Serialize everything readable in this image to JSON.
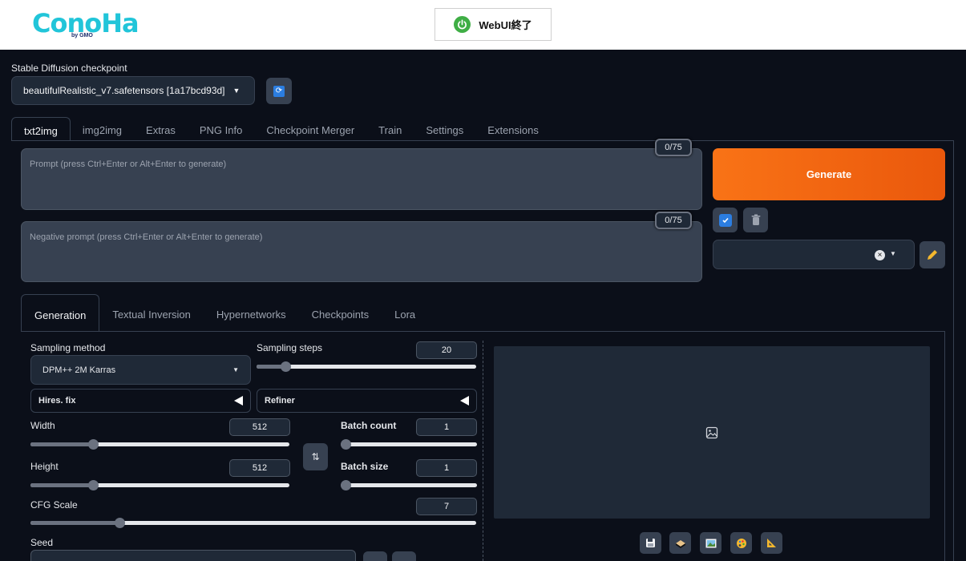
{
  "header": {
    "logo_text": "ConoHa",
    "logo_sub": "by GMO",
    "webui_button": "WebUI終了"
  },
  "checkpoint": {
    "label": "Stable Diffusion checkpoint",
    "value": "beautifulRealistic_v7.safetensors [1a17bcd93d]"
  },
  "tabs": [
    "txt2img",
    "img2img",
    "Extras",
    "PNG Info",
    "Checkpoint Merger",
    "Train",
    "Settings",
    "Extensions"
  ],
  "prompt": {
    "placeholder": "Prompt (press Ctrl+Enter or Alt+Enter to generate)",
    "counter": "0/75"
  },
  "negative_prompt": {
    "placeholder": "Negative prompt (press Ctrl+Enter or Alt+Enter to generate)",
    "counter": "0/75"
  },
  "generate_label": "Generate",
  "subtabs": [
    "Generation",
    "Textual Inversion",
    "Hypernetworks",
    "Checkpoints",
    "Lora"
  ],
  "generation": {
    "sampling_method_label": "Sampling method",
    "sampling_method_value": "DPM++ 2M Karras",
    "sampling_steps_label": "Sampling steps",
    "sampling_steps_value": "20",
    "sampling_steps_fraction": 0.13,
    "hires_label": "Hires. fix",
    "refiner_label": "Refiner",
    "width_label": "Width",
    "width_value": "512",
    "width_fraction": 0.24,
    "height_label": "Height",
    "height_value": "512",
    "height_fraction": 0.24,
    "batch_count_label": "Batch count",
    "batch_count_value": "1",
    "batch_size_label": "Batch size",
    "batch_size_value": "1",
    "cfg_label": "CFG Scale",
    "cfg_value": "7",
    "cfg_fraction": 0.2,
    "seed_label": "Seed"
  }
}
